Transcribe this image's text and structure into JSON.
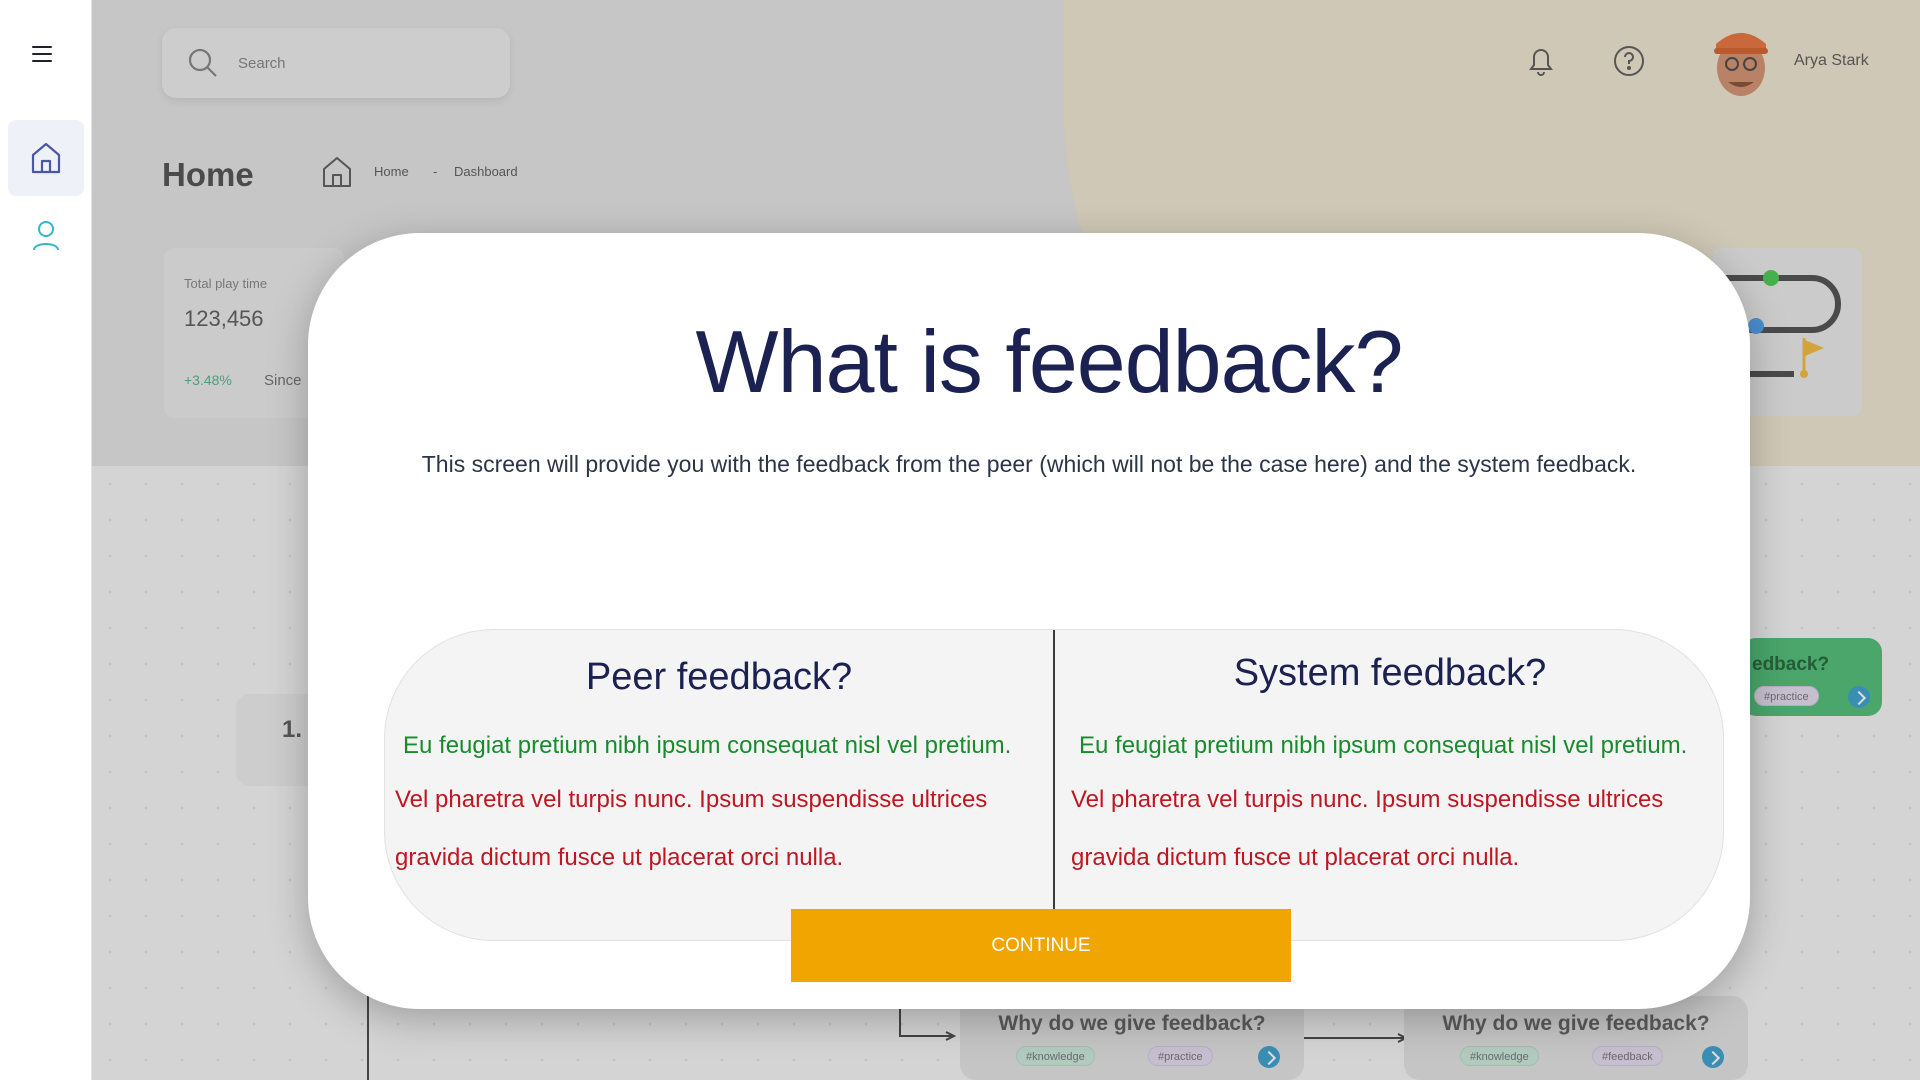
{
  "sidebar": {
    "menu_icon": "hamburger-menu-icon",
    "items": [
      {
        "icon": "home-icon",
        "active": true,
        "color": "#4a57a8"
      },
      {
        "icon": "user-icon",
        "active": false,
        "color": "#31b7c9"
      }
    ]
  },
  "header": {
    "search_placeholder": "Search",
    "user_name": "Arya Stark"
  },
  "page": {
    "title": "Home",
    "breadcrumb": {
      "home": "Home",
      "separator": "-",
      "current": "Dashboard"
    }
  },
  "stat_card": {
    "label": "Total play time",
    "value": "123,456",
    "change": "+3.48%",
    "since": "Since"
  },
  "background_cards": {
    "step_number": "1.",
    "green_card_title": "edback?",
    "green_card_tag": "#practice",
    "bottom_cards": [
      {
        "title": "Why do we give feedback?",
        "tags": [
          "#knowledge",
          "#practice"
        ]
      },
      {
        "title": "Why do we give feedback?",
        "tags": [
          "#knowledge",
          "#feedback"
        ]
      }
    ]
  },
  "modal": {
    "title": "What is feedback?",
    "subtitle": "This screen will provide you with the feedback from the peer (which will not be the case here) and the system feedback.",
    "columns": [
      {
        "title": "Peer feedback?",
        "green_line": "Eu feugiat pretium nibh ipsum consequat nisl vel pretium.",
        "red_lines": [
          "Vel pharetra vel turpis nunc. Ipsum suspendisse ultrices",
          "gravida dictum fusce ut placerat orci nulla."
        ]
      },
      {
        "title": "System feedback?",
        "green_line": "Eu feugiat pretium nibh ipsum consequat nisl vel pretium.",
        "red_lines": [
          "Vel pharetra vel turpis nunc. Ipsum suspendisse ultrices",
          "gravida dictum fusce ut placerat orci nulla."
        ]
      }
    ],
    "continue_label": "CONTINUE"
  },
  "colors": {
    "accent": "#f0a500",
    "title_navy": "#1b2150",
    "positive_green": "#198b2c",
    "negative_red": "#bf1721"
  }
}
